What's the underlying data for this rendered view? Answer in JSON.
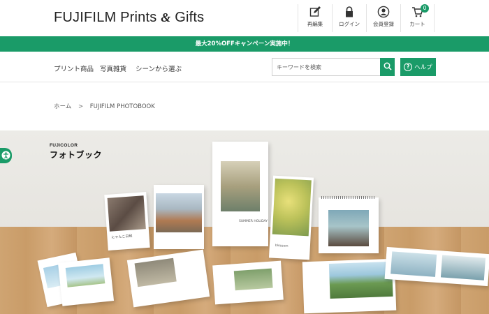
{
  "header": {
    "logo_text": "FUJIFILM Prints",
    "logo_amp": "&",
    "logo_suffix": "Gifts",
    "nav": [
      {
        "label": "再編集",
        "icon": "edit-icon"
      },
      {
        "label": "ログイン",
        "icon": "lock-icon"
      },
      {
        "label": "会員登録",
        "icon": "user-icon"
      },
      {
        "label": "カート",
        "icon": "cart-icon",
        "badge": "0"
      }
    ]
  },
  "promo": {
    "text": "最大20%OFFキャンペーン実施中！"
  },
  "subnav": {
    "items": [
      "プリント商品",
      "写真雑貨",
      "シーンから選ぶ"
    ],
    "search_placeholder": "キーワードを検索",
    "help_label": "ヘルプ",
    "help_icon": "question-icon"
  },
  "breadcrumb": {
    "home": "ホーム",
    "separator": ">",
    "current": "FUJIFILM PHOTOBOOK"
  },
  "hero": {
    "brand_small": "FUJICOLOR",
    "brand_big": "フォトブック",
    "side_tab_icon": "accessibility-icon",
    "cover_texts": [
      "にゃんこ日和",
      "SUMMER HOLIDAY",
      "blossom"
    ]
  },
  "colors": {
    "accent": "#1a9b68",
    "text": "#333333",
    "border": "#e3e3e3"
  }
}
